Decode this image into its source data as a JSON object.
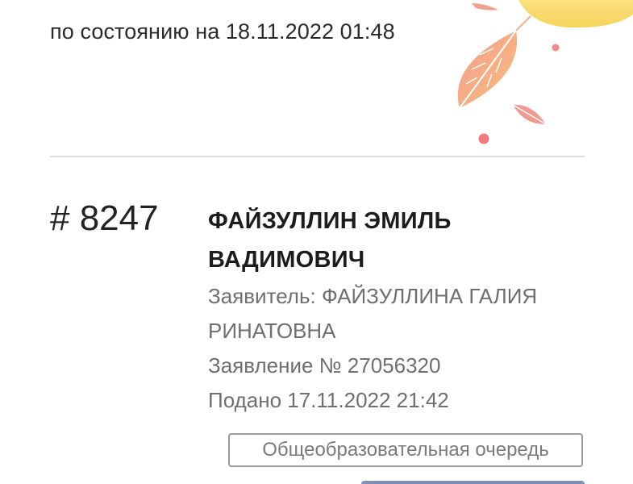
{
  "header": {
    "status_text": "по состоянию на 18.11.2022 01:48"
  },
  "application": {
    "queue_number": "# 8247",
    "child_name_line1": "ФАЙЗУЛЛИН ЭМИЛЬ",
    "child_name_line2": "ВАДИМОВИЧ",
    "applicant_line1": "Заявитель: ФАЙЗУЛЛИНА ГАЛИЯ",
    "applicant_line2": "РИНАТОВНА",
    "application_number": "Заявление № 27056320",
    "submitted": "Подано 17.11.2022 21:42",
    "queue_type": "Общеобразовательная очередь"
  },
  "decor": {
    "icons": [
      "sun-icon",
      "leaf-icon",
      "berry-icon"
    ]
  },
  "colors": {
    "text_primary": "#1c1c1c",
    "text_secondary": "#6f6f6f",
    "tag_border": "#9a9a9a",
    "button": "#7f8fb8",
    "sun": "#f8e07a",
    "leaf": "#f4a58c"
  }
}
